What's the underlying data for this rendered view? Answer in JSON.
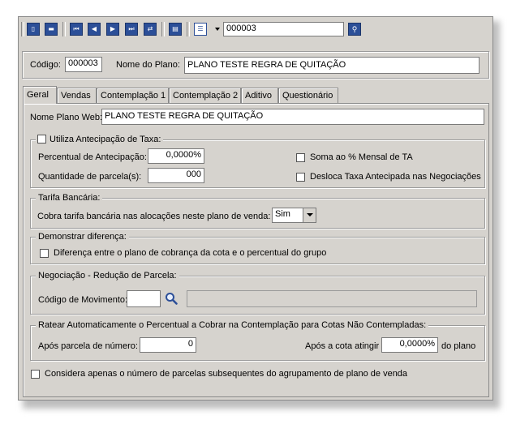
{
  "toolbar": {
    "icons": [
      "new-icon",
      "delete-icon",
      "first-icon",
      "previous-icon",
      "next-icon",
      "last-icon",
      "refresh-icon",
      "print-icon",
      "list-icon",
      "search-icon"
    ],
    "search_value": "000003"
  },
  "header": {
    "codigo_label": "Código:",
    "codigo_value": "000003",
    "nome_label": "Nome do Plano:",
    "nome_value": "PLANO TESTE REGRA DE QUITAÇÃO"
  },
  "tabs": [
    {
      "label": "Geral",
      "active": true
    },
    {
      "label": "Vendas"
    },
    {
      "label": "Contemplação 1"
    },
    {
      "label": "Contemplação 2"
    },
    {
      "label": "Aditivo"
    },
    {
      "label": "Questionário"
    }
  ],
  "geral": {
    "nome_web_label": "Nome Plano Web:",
    "nome_web_value": "PLANO TESTE REGRA DE QUITAÇÃO",
    "antecipacao": {
      "legend": "Utiliza Antecipação de Taxa:",
      "percentual_label": "Percentual de Antecipação:",
      "percentual_value": "0,0000%",
      "quantidade_label": "Quantidade de parcela(s):",
      "quantidade_value": "000",
      "soma_label": "Soma ao % Mensal de TA",
      "desloca_label": "Desloca Taxa Antecipada nas Negociações"
    },
    "tarifa": {
      "legend": "Tarifa Bancária:",
      "cobra_label": "Cobra tarifa bancária nas alocações neste plano de venda:",
      "cobra_value": "Sim"
    },
    "demonstrar": {
      "legend": "Demonstrar diferença:",
      "diferenca_label": "Diferença entre o plano de cobrança da cota e o percentual do grupo"
    },
    "negociacao": {
      "legend": "Negociação - Redução de Parcela:",
      "codigo_mov_label": "Código de Movimento:",
      "codigo_mov_value": "",
      "descricao_value": ""
    },
    "ratear": {
      "legend": "Ratear Automaticamente o Percentual a Cobrar na Contemplação para Cotas Não Contempladas:",
      "apos_parcela_label": "Após parcela de número:",
      "apos_parcela_value": "0",
      "apos_cota_label": "Após a cota atingir",
      "apos_cota_value": "0,0000%",
      "do_plano_label": "do plano"
    },
    "considera_label": "Considera apenas o número de parcelas subsequentes do agrupamento de plano de venda"
  }
}
